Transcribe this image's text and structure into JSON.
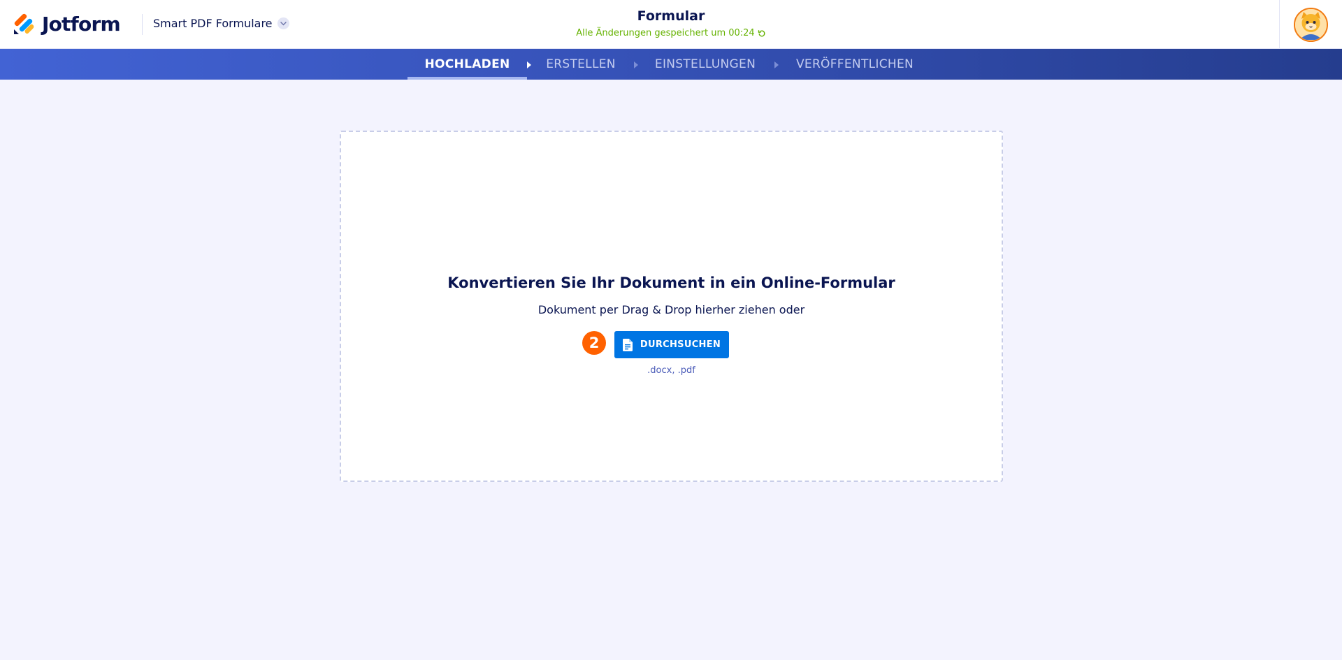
{
  "header": {
    "brand": "Jotform",
    "product_switcher_label": "Smart PDF Formulare",
    "form_title": "Formular",
    "save_status": "Alle Änderungen gespeichert um 00:24",
    "icons": {
      "logo": "jotform-logo-icon",
      "switcher": "chevron-down-icon",
      "status": "refresh-icon",
      "avatar": "avatar-icon"
    }
  },
  "nav": {
    "steps": [
      {
        "label": "HOCHLADEN",
        "active": true
      },
      {
        "label": "ERSTELLEN",
        "active": false
      },
      {
        "label": "EINSTELLUNGEN",
        "active": false
      },
      {
        "label": "VERÖFFENTLICHEN",
        "active": false
      }
    ]
  },
  "upload": {
    "title": "Konvertieren Sie Ihr Dokument in ein Online-Formular",
    "subtitle": "Dokument per Drag & Drop hierher ziehen oder",
    "step_number": "2",
    "browse_label": "DURCHSUCHEN",
    "browse_icon": "document-icon",
    "accepted_types": ".docx, .pdf"
  },
  "colors": {
    "brand_navy": "#0a1551",
    "status_green": "#64b200",
    "primary_button": "#0075e3",
    "step_badge": "#ff6100",
    "background": "#f3f3fe"
  }
}
